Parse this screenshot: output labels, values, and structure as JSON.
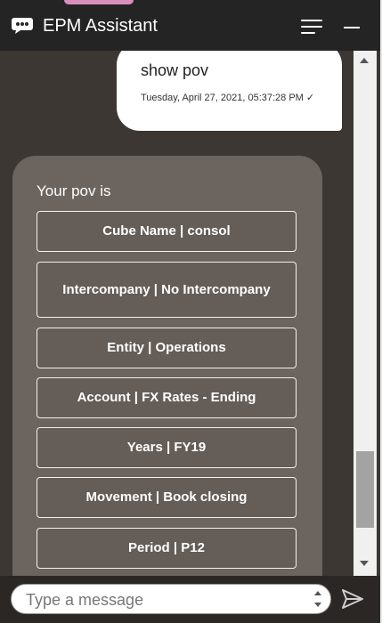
{
  "header": {
    "title": "EPM Assistant"
  },
  "user_message": {
    "text": "show pov",
    "timestamp": "Tuesday, April 27, 2021, 05:37:28 PM ✓"
  },
  "bot_message": {
    "intro": "Your pov is",
    "buttons": [
      "Cube Name | consol",
      "Intercompany | No Intercompany",
      "Entity | Operations",
      "Account | FX Rates - Ending",
      "Years | FY19",
      "Movement | Book closing",
      "Period | P12"
    ]
  },
  "composer": {
    "placeholder": "Type a message"
  },
  "colors": {
    "header_bg": "#242424",
    "chat_bg": "#3d3733",
    "bot_bubble": "#6b645f",
    "user_bubble": "#ffffff"
  },
  "icons": [
    "chat-bubble-icon",
    "menu-icon",
    "minimize-icon",
    "scroll-up-icon",
    "scroll-down-icon",
    "send-icon"
  ]
}
